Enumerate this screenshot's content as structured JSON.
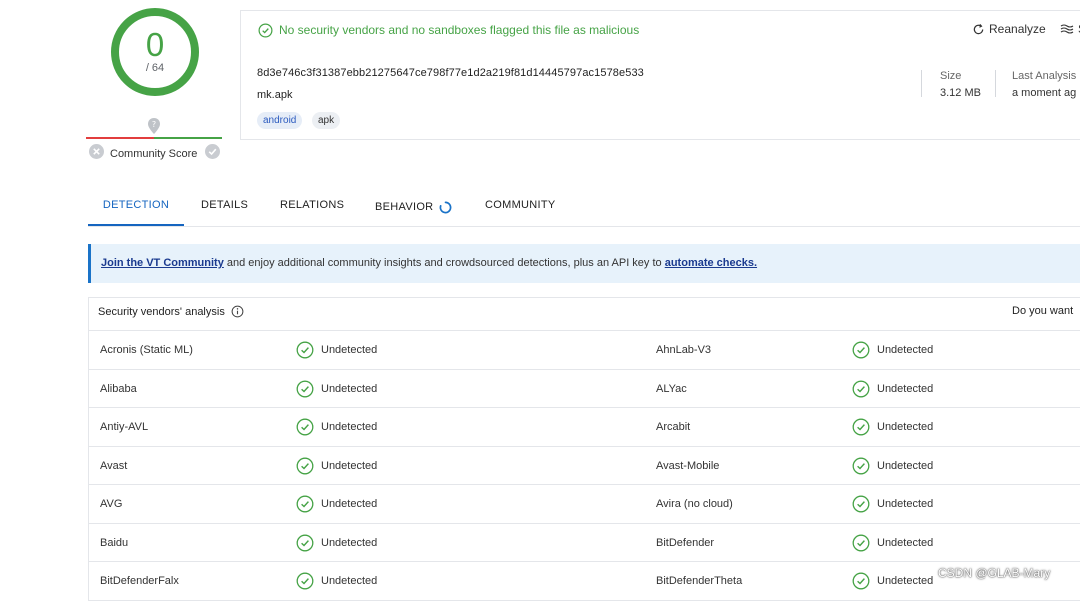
{
  "score": {
    "value": "0",
    "total": "/ 64",
    "color": "#46a346"
  },
  "community": {
    "label": "Community Score",
    "marker_icon": "map-pin-icon"
  },
  "status": {
    "text": "No security vendors and no sandboxes flagged this file as malicious",
    "icon": "check-circle-icon"
  },
  "actions": {
    "reanalyze": "Reanalyze",
    "similar": "S"
  },
  "file": {
    "hash": "8d3e746c3f31387ebb21275647ce798f77e1d2a219f81d14445797ac1578e533",
    "name": "mk.apk",
    "tags": [
      "android",
      "apk"
    ],
    "size_label": "Size",
    "size_value": "3.12 MB",
    "last_label": "Last Analysis",
    "last_value": "a moment ag"
  },
  "tabs": [
    "DETECTION",
    "DETAILS",
    "RELATIONS",
    "BEHAVIOR",
    "COMMUNITY"
  ],
  "banner": {
    "link1": "Join the VT Community",
    "middle": " and enjoy additional community insights and crowdsourced detections, plus an API key to ",
    "link2": "automate checks."
  },
  "vendors": {
    "title": "Security vendors' analysis",
    "right_text": "Do you want",
    "rows": [
      [
        "Acronis (Static ML)",
        "Undetected",
        "AhnLab-V3",
        "Undetected"
      ],
      [
        "Alibaba",
        "Undetected",
        "ALYac",
        "Undetected"
      ],
      [
        "Antiy-AVL",
        "Undetected",
        "Arcabit",
        "Undetected"
      ],
      [
        "Avast",
        "Undetected",
        "Avast-Mobile",
        "Undetected"
      ],
      [
        "AVG",
        "Undetected",
        "Avira (no cloud)",
        "Undetected"
      ],
      [
        "Baidu",
        "Undetected",
        "BitDefender",
        "Undetected"
      ],
      [
        "BitDefenderFalx",
        "Undetected",
        "BitDefenderTheta",
        "Undetected"
      ]
    ]
  },
  "colors": {
    "accent": "#1565c0",
    "clean": "#46a346",
    "malicious": "#e23e3e"
  },
  "watermark": "CSDN @GLAB-Mary"
}
